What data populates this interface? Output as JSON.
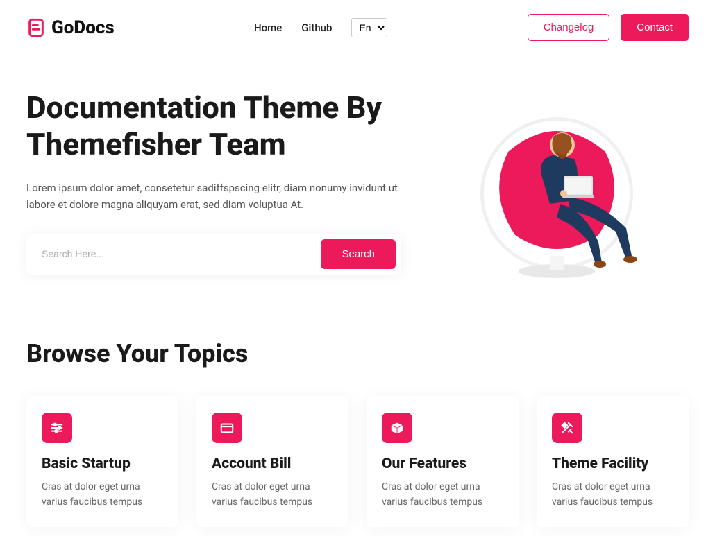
{
  "brand": {
    "name": "GoDocs"
  },
  "nav": {
    "home": "Home",
    "github": "Github",
    "lang": "En",
    "changelog": "Changelog",
    "contact": "Contact"
  },
  "hero": {
    "title": "Documentation Theme By Themefisher Team",
    "description": "Lorem ipsum dolor amet, consetetur sadiffspscing elitr, diam nonumy invidunt ut labore et dolore magna aliquyam erat, sed diam voluptua At.",
    "search_placeholder": "Search Here...",
    "search_button": "Search"
  },
  "topics": {
    "heading": "Browse Your Topics",
    "cards": [
      {
        "title": "Basic Startup",
        "desc": "Cras at dolor eget urna varius faucibus tempus"
      },
      {
        "title": "Account Bill",
        "desc": "Cras at dolor eget urna varius faucibus tempus"
      },
      {
        "title": "Our Features",
        "desc": "Cras at dolor eget urna varius faucibus tempus"
      },
      {
        "title": "Theme Facility",
        "desc": "Cras at dolor eget urna varius faucibus tempus"
      }
    ]
  },
  "colors": {
    "accent": "#ED1A5B"
  }
}
